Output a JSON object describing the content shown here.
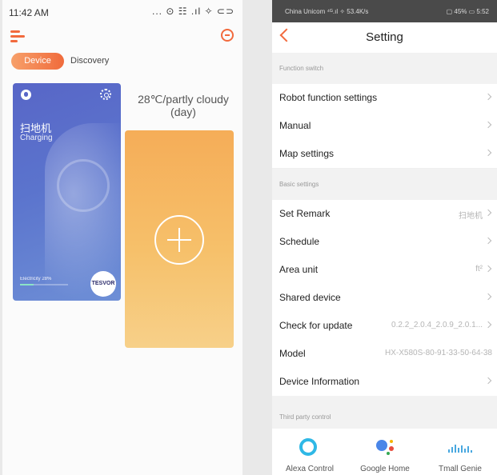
{
  "left": {
    "status": {
      "time": "11:42 AM",
      "icons": "... ⊙ ☷ .ıl ✧ ⊂⊃"
    },
    "tabs": {
      "device": "Device",
      "discovery": "Discovery"
    },
    "robot": {
      "name": "扫地机",
      "status": "Charging",
      "electricity": "Electricity 28%",
      "electricity_level": 0.28,
      "brand": "TESVOR"
    },
    "weather": "28℃/partly cloudy (day)"
  },
  "right": {
    "status": {
      "carrier": "China Unicom ⁴ᴳ.ıl ✧ 53.4K/s",
      "right": "▢ 45% ▭ 5:52"
    },
    "title": "Setting",
    "sections": {
      "function": "Function switch",
      "basic": "Basic settings",
      "third": "Third party control"
    },
    "rows": [
      {
        "label": "Robot function settings",
        "value": ""
      },
      {
        "label": "Manual",
        "value": ""
      },
      {
        "label": "Map settings",
        "value": ""
      },
      {
        "label": "Set Remark",
        "value": "扫地机"
      },
      {
        "label": "Schedule",
        "value": ""
      },
      {
        "label": "Area unit",
        "value": "ft²"
      },
      {
        "label": "Shared device",
        "value": ""
      },
      {
        "label": "Check for update",
        "value": "0.2.2_2.0.4_2.0.9_2.0.1..."
      },
      {
        "label": "Model",
        "value": "HX-X580S-80-91-33-50-64-38"
      },
      {
        "label": "Device Information",
        "value": ""
      }
    ],
    "third_party": [
      {
        "label": "Alexa Control"
      },
      {
        "label": "Google Home"
      },
      {
        "label": "Tmall Genie"
      }
    ]
  },
  "colors": {
    "accent": "#f26a3d",
    "card_blue": "#5866c7",
    "card_orange": "#f6b45f"
  }
}
